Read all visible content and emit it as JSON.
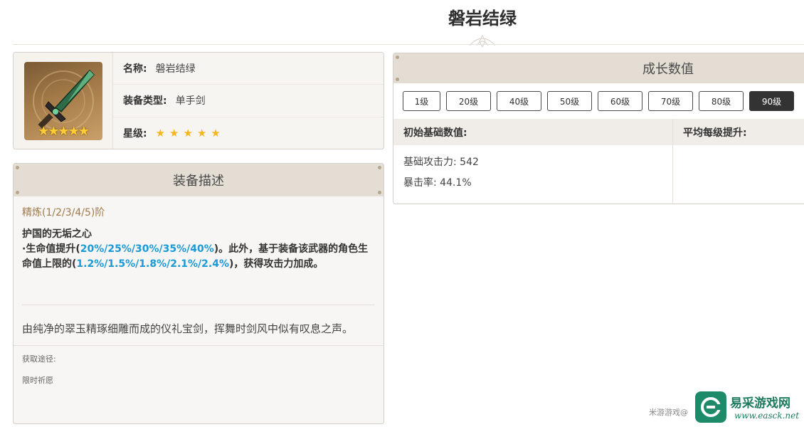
{
  "page": {
    "title": "磐岩结绿"
  },
  "info": {
    "name_key": "名称:",
    "name_value": "磐岩结绿",
    "type_key": "装备类型:",
    "type_value": "单手剑",
    "rarity_key": "星级:",
    "rarity_stars": "★★★★★",
    "rarity": 5,
    "thumb_stars": "★★★★★"
  },
  "description": {
    "header": "装备描述",
    "refine": "精炼(1/2/3/4/5)阶",
    "skill_name": "护国的无垢之心",
    "skill_p1": "·生命值提升(",
    "skill_h1": "20%/25%/30%/35%/40%",
    "skill_p2": ")。此外，基于装备该武器的角色生命值上限的(",
    "skill_h2": "1.2%/1.5%/1.8%/2.1%/2.4%",
    "skill_p3": ")，获得攻击力加成。",
    "flavor": "由纯净的翠玉精琢细雕而成的仪礼宝剑，挥舞时剑风中似有叹息之声。",
    "source_label": "获取途径:",
    "source_value": "限时祈愿"
  },
  "growth": {
    "header": "成长数值",
    "levels": [
      "1级",
      "20级",
      "40级",
      "50级",
      "60级",
      "70级",
      "80级",
      "90级"
    ],
    "active_level": "90级",
    "col_base": "初始基础数值:",
    "col_avg": "平均每级提升:",
    "stat_1": "基础攻击力: 542",
    "stat_2": "暴击率: 44.1%"
  },
  "watermark": {
    "text": "米游游戏@",
    "site_name": "易采游戏网",
    "site_url": "www.easck.net"
  },
  "colors": {
    "highlight": "#1a9ad6",
    "refine": "#a07a4b",
    "star": "#f5b61e",
    "panel_header": "#e3ddd3",
    "brand_green": "#1d8b69"
  }
}
